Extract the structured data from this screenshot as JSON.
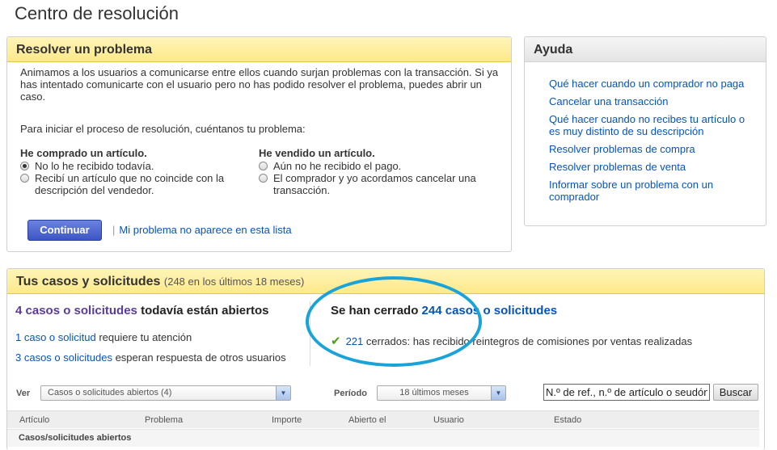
{
  "page": {
    "title": "Centro de resolución"
  },
  "resolve": {
    "title": "Resolver un problema",
    "intro": "Animamos a los usuarios a comunicarse entre ellos cuando surjan problemas con la transacción. Si ya has intentado comunicarte con el usuario pero no has podido resolver el problema, puedes abrir un caso.",
    "prompt": "Para iniciar el proceso de resolución, cuéntanos tu problema:",
    "bought": {
      "heading": "He comprado un artículo.",
      "options": [
        "No lo he recibido todavía.",
        "Recibí un artículo que no coincide con la descripción del vendedor."
      ],
      "selected_index": 0
    },
    "sold": {
      "heading": "He vendido un artículo.",
      "options": [
        "Aún no he recibido el pago.",
        "El comprador y yo acordamos cancelar una transacción."
      ]
    },
    "continue_label": "Continuar",
    "separator": "|",
    "alt_link": "Mi problema no aparece en esta lista"
  },
  "help": {
    "title": "Ayuda",
    "links": [
      "Qué hacer cuando un comprador no paga",
      "Cancelar una transacción",
      "Qué hacer cuando no recibes tu artículo o es muy distinto de su descripción",
      "Resolver problemas de compra",
      "Resolver problemas de venta",
      "Informar sobre un problema con un comprador"
    ]
  },
  "cases": {
    "title": "Tus casos y solicitudes",
    "count_text": "(248 en los últimos 18 meses)",
    "open": {
      "title_num": "4 casos o solicitudes",
      "title_rest": " todavía están abiertos",
      "line1_link": "1 caso o solicitud",
      "line1_rest": " requiere tu atención",
      "line2_link": "3 casos o solicitudes",
      "line2_rest": " esperan respuesta de otros usuarios"
    },
    "closed": {
      "title_pre": "Se han cerrado ",
      "title_num": "244 casos o solicitudes",
      "line_link": "221",
      "line_rest": " cerrados: has recibido reintegros de comisiones por ventas realizadas"
    },
    "filters": {
      "ver_label": "Ver",
      "ver_value": "Casos o solicitudes abiertos (4)",
      "periodo_label": "Período",
      "periodo_value": "18 últimos meses",
      "search_value": "N.º de ref., n.º de artículo o seudón",
      "search_button": "Buscar"
    },
    "columns": [
      "Artículo",
      "Problema",
      "Importe",
      "Abierto el",
      "Usuario",
      "Estado"
    ],
    "group_label": "Casos/solicitudes abiertos"
  },
  "colors": {
    "accent": "#1aa3d9",
    "link": "#0654ba",
    "open_count": "#5a3c9a",
    "check": "#4aa00f"
  }
}
